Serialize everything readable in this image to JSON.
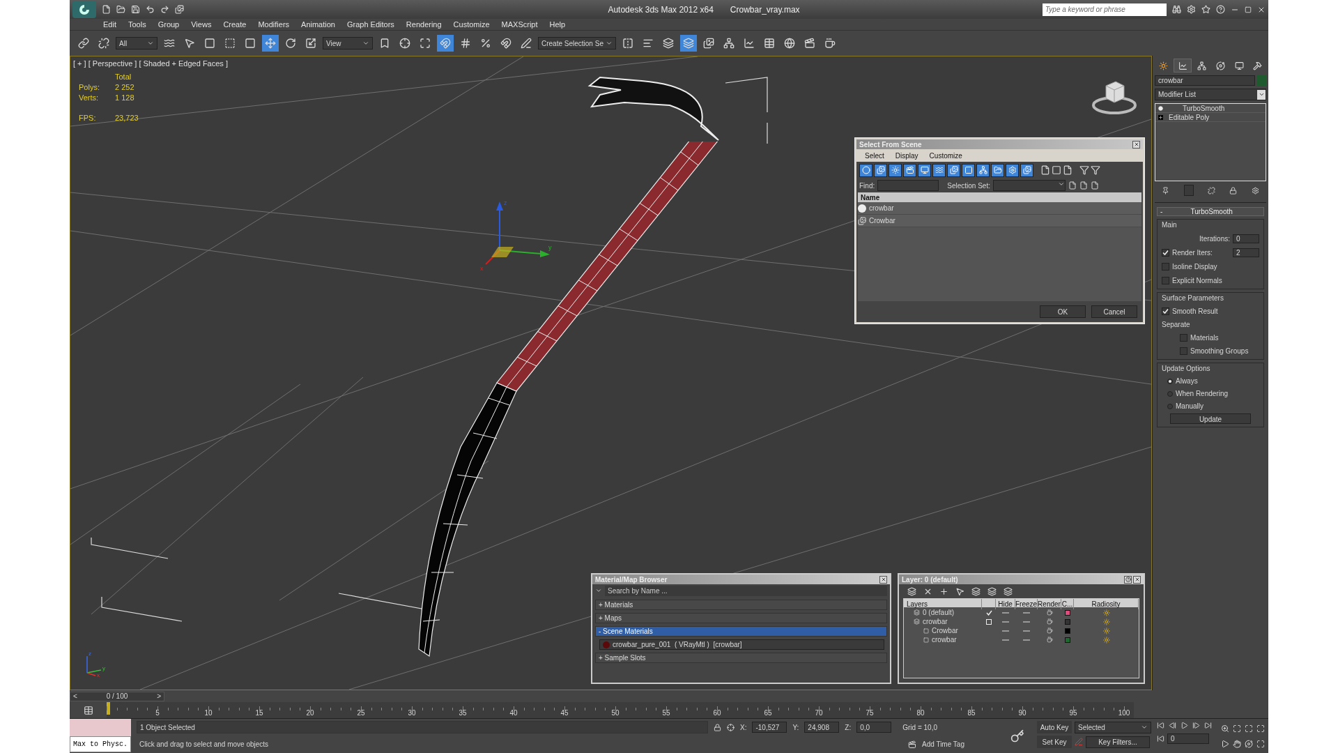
{
  "title_bar": {
    "app": "Autodesk 3ds Max  2012 x64",
    "file": "Crowbar_vray.max",
    "search_placeholder": "Type a keyword or phrase"
  },
  "menus": [
    "Edit",
    "Tools",
    "Group",
    "Views",
    "Create",
    "Modifiers",
    "Animation",
    "Graph Editors",
    "Rendering",
    "Customize",
    "MAXScript",
    "Help"
  ],
  "toolbar": {
    "filter": "All",
    "reference": "View",
    "selection_set": "Create Selection Se",
    "buttons": [
      {
        "selected": false
      },
      {
        "selected": false
      },
      {
        "selected": false
      },
      {
        "selected": false
      },
      {
        "selected": false
      },
      {
        "selected": false
      },
      {
        "selected": false
      },
      {
        "selected": true
      },
      {
        "selected": false
      },
      {
        "selected": false
      },
      {
        "selected": false
      },
      {
        "selected": false
      },
      {
        "selected": false
      },
      {
        "selected": true
      },
      {
        "selected": false
      },
      {
        "selected": false
      },
      {
        "selected": false
      },
      {
        "selected": false
      },
      {
        "selected": false
      },
      {
        "selected": false
      },
      {
        "selected": false
      },
      {
        "selected": true
      },
      {
        "selected": false
      },
      {
        "selected": false
      },
      {
        "selected": false
      },
      {
        "selected": false
      },
      {
        "selected": false
      },
      {
        "selected": false
      },
      {
        "selected": false
      }
    ]
  },
  "viewport": {
    "label": "[ + ] [ Perspective ] [ Shaded + Edged Faces ]",
    "stats_header": "Total",
    "stats": [
      {
        "label": "Polys:",
        "value": "2 252"
      },
      {
        "label": "Verts:",
        "value": "1 128"
      },
      {
        "label": "FPS:",
        "value": "23,723"
      }
    ],
    "gizmo_axes": [
      "z",
      "y",
      "x"
    ],
    "tripod_axes": [
      "z",
      "y",
      "x"
    ]
  },
  "select_from_scene": {
    "title": "Select From Scene",
    "menus": [
      "Select",
      "Display",
      "Customize"
    ],
    "find_label": "Find:",
    "selection_set_label": "Selection Set:",
    "column": "Name",
    "rows": [
      {
        "kind": "geometry",
        "name": "crowbar"
      },
      {
        "kind": "group",
        "name": "Crowbar"
      }
    ],
    "buttons": [
      "OK",
      "Cancel"
    ]
  },
  "material_browser": {
    "title": "Material/Map Browser",
    "search_placeholder": "Search by Name ...",
    "sections": [
      {
        "label": "+ Materials",
        "expanded": false
      },
      {
        "label": "+ Maps",
        "expanded": false
      },
      {
        "label": "- Scene Materials",
        "expanded": true,
        "items": [
          "crowbar_pure_001  ( VRayMtl )  [crowbar]"
        ]
      },
      {
        "label": "+ Sample Slots",
        "expanded": false
      }
    ]
  },
  "layer_dialog": {
    "title": "Layer: 0 (default)",
    "columns": [
      "Layers",
      "Hide",
      "Freeze",
      "Render",
      "C...",
      "Radiosity"
    ],
    "layers": [
      {
        "kind": "layer",
        "name": "0 (default)",
        "current": true,
        "color": "#e04a7c"
      },
      {
        "kind": "layer",
        "name": "crowbar",
        "current": false,
        "color": "#333333",
        "children": [
          {
            "kind": "object",
            "name": "Crowbar",
            "color": "#000000"
          },
          {
            "kind": "object",
            "name": "crowbar",
            "color": "#1c6a30"
          }
        ]
      }
    ]
  },
  "command_panel": {
    "object_name": "crowbar",
    "modifier_list": "Modifier List",
    "stack": [
      {
        "kind": "modifier",
        "name": "TurboSmooth"
      },
      {
        "kind": "base",
        "name": "Editable Poly"
      }
    ],
    "rollout": {
      "title": "TurboSmooth",
      "toggle": "-",
      "main": {
        "title": "Main",
        "iterations_label": "Iterations:",
        "iterations": "0",
        "render_iters_label": "Render Iters:",
        "render_iters": "2",
        "render_iters_checked": true,
        "checks": [
          {
            "label": "Isoline Display",
            "checked": false
          },
          {
            "label": "Explicit Normals",
            "checked": false
          }
        ]
      },
      "surface": {
        "title": "Surface Parameters",
        "smooth_result": {
          "label": "Smooth Result",
          "checked": true
        },
        "separate": "Separate",
        "checks": [
          {
            "label": "Materials",
            "checked": false
          },
          {
            "label": "Smoothing Groups",
            "checked": false
          }
        ]
      },
      "update": {
        "title": "Update Options",
        "options": [
          {
            "label": "Always",
            "selected": true
          },
          {
            "label": "When Rendering",
            "selected": false
          },
          {
            "label": "Manually",
            "selected": false
          }
        ],
        "button": "Update"
      }
    }
  },
  "timeline": {
    "frame": "0 / 100",
    "prev": "<",
    "next": ">",
    "ticks": [
      "5",
      "10",
      "15",
      "20",
      "25",
      "30",
      "35",
      "40",
      "45",
      "50",
      "55",
      "60",
      "65",
      "70",
      "75",
      "80",
      "85",
      "90",
      "95",
      "100"
    ]
  },
  "status_bar": {
    "script_listener": "Max to Physc.",
    "selection": "1 Object Selected",
    "prompt": "Click and drag to select and move objects",
    "coords": [
      {
        "label": "X:",
        "value": "-10,527"
      },
      {
        "label": "Y:",
        "value": "24,908"
      },
      {
        "label": "Z:",
        "value": "0,0"
      }
    ],
    "grid": "Grid = 10,0",
    "add_time_tag": "Add Time Tag",
    "auto_key": "Auto Key",
    "set_key": "Set Key",
    "key_mode": "Selected",
    "key_filters": "Key Filters...",
    "current_frame": "0"
  }
}
